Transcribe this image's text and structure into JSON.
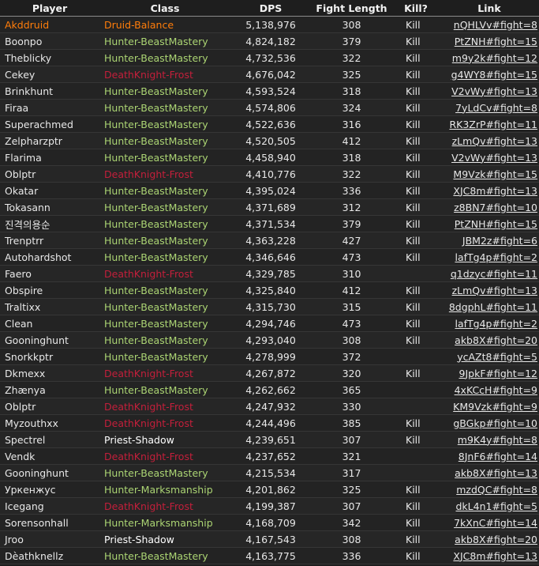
{
  "columns": [
    "Player",
    "Class",
    "DPS",
    "Fight Length",
    "Kill?",
    "Link"
  ],
  "colors": {
    "Druid-Balance": "#ff7d0a",
    "Hunter-BeastMastery": "#abd473",
    "Hunter-Marksmanship": "#abd473",
    "DeathKnight-Frost": "#c41f3b",
    "Priest-Shadow": "#ffffff",
    "highlight_player": "#ff7d0a"
  },
  "rows": [
    {
      "player": "Akddruid",
      "class": "Druid-Balance",
      "dps": "5,138,976",
      "fight": "308",
      "kill": "Kill",
      "link": "nQHLVv#fight=8",
      "highlight": true
    },
    {
      "player": "Boonpo",
      "class": "Hunter-BeastMastery",
      "dps": "4,824,182",
      "fight": "379",
      "kill": "Kill",
      "link": "PtZNH#fight=15"
    },
    {
      "player": "Theblicky",
      "class": "Hunter-BeastMastery",
      "dps": "4,732,536",
      "fight": "322",
      "kill": "Kill",
      "link": "m9y2k#fight=12"
    },
    {
      "player": "Cekey",
      "class": "DeathKnight-Frost",
      "dps": "4,676,042",
      "fight": "325",
      "kill": "Kill",
      "link": "g4WY8#fight=15"
    },
    {
      "player": "Brinkhunt",
      "class": "Hunter-BeastMastery",
      "dps": "4,593,524",
      "fight": "318",
      "kill": "Kill",
      "link": "V2vWy#fight=13"
    },
    {
      "player": "Firaa",
      "class": "Hunter-BeastMastery",
      "dps": "4,574,806",
      "fight": "324",
      "kill": "Kill",
      "link": "7yLdCv#fight=8"
    },
    {
      "player": "Superachmed",
      "class": "Hunter-BeastMastery",
      "dps": "4,522,636",
      "fight": "316",
      "kill": "Kill",
      "link": "RK3ZrP#fight=11"
    },
    {
      "player": "Zelpharzptr",
      "class": "Hunter-BeastMastery",
      "dps": "4,520,505",
      "fight": "412",
      "kill": "Kill",
      "link": "zLmQv#fight=13"
    },
    {
      "player": "Flarima",
      "class": "Hunter-BeastMastery",
      "dps": "4,458,940",
      "fight": "318",
      "kill": "Kill",
      "link": "V2vWy#fight=13"
    },
    {
      "player": "Oblptr",
      "class": "DeathKnight-Frost",
      "dps": "4,410,776",
      "fight": "322",
      "kill": "Kill",
      "link": "M9Vzk#fight=15"
    },
    {
      "player": "Okatar",
      "class": "Hunter-BeastMastery",
      "dps": "4,395,024",
      "fight": "336",
      "kill": "Kill",
      "link": "XJC8m#fight=13"
    },
    {
      "player": "Tokasann",
      "class": "Hunter-BeastMastery",
      "dps": "4,371,689",
      "fight": "312",
      "kill": "Kill",
      "link": "z8BN7#fight=10"
    },
    {
      "player": "진격의용순",
      "class": "Hunter-BeastMastery",
      "dps": "4,371,534",
      "fight": "379",
      "kill": "Kill",
      "link": "PtZNH#fight=15"
    },
    {
      "player": "Trenptrr",
      "class": "Hunter-BeastMastery",
      "dps": "4,363,228",
      "fight": "427",
      "kill": "Kill",
      "link": "JBM2z#fight=6"
    },
    {
      "player": "Autohardshot",
      "class": "Hunter-BeastMastery",
      "dps": "4,346,646",
      "fight": "473",
      "kill": "Kill",
      "link": "lafTg4p#fight=2"
    },
    {
      "player": "Faero",
      "class": "DeathKnight-Frost",
      "dps": "4,329,785",
      "fight": "310",
      "kill": "",
      "link": "q1dzyc#fight=11"
    },
    {
      "player": "Obspire",
      "class": "Hunter-BeastMastery",
      "dps": "4,325,840",
      "fight": "412",
      "kill": "Kill",
      "link": "zLmQv#fight=13"
    },
    {
      "player": "Traltixx",
      "class": "Hunter-BeastMastery",
      "dps": "4,315,730",
      "fight": "315",
      "kill": "Kill",
      "link": "8dgphL#fight=11"
    },
    {
      "player": "Clean",
      "class": "Hunter-BeastMastery",
      "dps": "4,294,746",
      "fight": "473",
      "kill": "Kill",
      "link": "lafTg4p#fight=2"
    },
    {
      "player": "Gooninghunt",
      "class": "Hunter-BeastMastery",
      "dps": "4,293,040",
      "fight": "308",
      "kill": "Kill",
      "link": "akb8X#fight=20"
    },
    {
      "player": "Snorkkptr",
      "class": "Hunter-BeastMastery",
      "dps": "4,278,999",
      "fight": "372",
      "kill": "",
      "link": "ycAZt8#fight=5"
    },
    {
      "player": "Dkmexx",
      "class": "DeathKnight-Frost",
      "dps": "4,267,872",
      "fight": "320",
      "kill": "Kill",
      "link": "9JpkF#fight=12"
    },
    {
      "player": "Zhænya",
      "class": "Hunter-BeastMastery",
      "dps": "4,262,662",
      "fight": "365",
      "kill": "",
      "link": "4xKCcH#fight=9"
    },
    {
      "player": "Oblptr",
      "class": "DeathKnight-Frost",
      "dps": "4,247,932",
      "fight": "330",
      "kill": "",
      "link": "KM9Vzk#fight=9"
    },
    {
      "player": "Myzouthxx",
      "class": "DeathKnight-Frost",
      "dps": "4,244,496",
      "fight": "385",
      "kill": "Kill",
      "link": "gBGkp#fight=10"
    },
    {
      "player": "Spectrel",
      "class": "Priest-Shadow",
      "dps": "4,239,651",
      "fight": "307",
      "kill": "Kill",
      "link": "m9K4y#fight=8"
    },
    {
      "player": "Vendk",
      "class": "DeathKnight-Frost",
      "dps": "4,237,652",
      "fight": "321",
      "kill": "",
      "link": "8JnF6#fight=14"
    },
    {
      "player": "Gooninghunt",
      "class": "Hunter-BeastMastery",
      "dps": "4,215,534",
      "fight": "317",
      "kill": "",
      "link": "akb8X#fight=13"
    },
    {
      "player": "Уркенжус",
      "class": "Hunter-Marksmanship",
      "dps": "4,201,862",
      "fight": "325",
      "kill": "Kill",
      "link": "mzdQC#fight=8"
    },
    {
      "player": "Icegang",
      "class": "DeathKnight-Frost",
      "dps": "4,199,387",
      "fight": "307",
      "kill": "Kill",
      "link": "dkL4n1#fight=5"
    },
    {
      "player": "Sorensonhall",
      "class": "Hunter-Marksmanship",
      "dps": "4,168,709",
      "fight": "342",
      "kill": "Kill",
      "link": "7kXnC#fight=14"
    },
    {
      "player": "Jroo",
      "class": "Priest-Shadow",
      "dps": "4,167,543",
      "fight": "308",
      "kill": "Kill",
      "link": "akb8X#fight=20"
    },
    {
      "player": "Dèathknellz",
      "class": "Hunter-BeastMastery",
      "dps": "4,163,775",
      "fight": "336",
      "kill": "Kill",
      "link": "XJC8m#fight=13"
    }
  ]
}
